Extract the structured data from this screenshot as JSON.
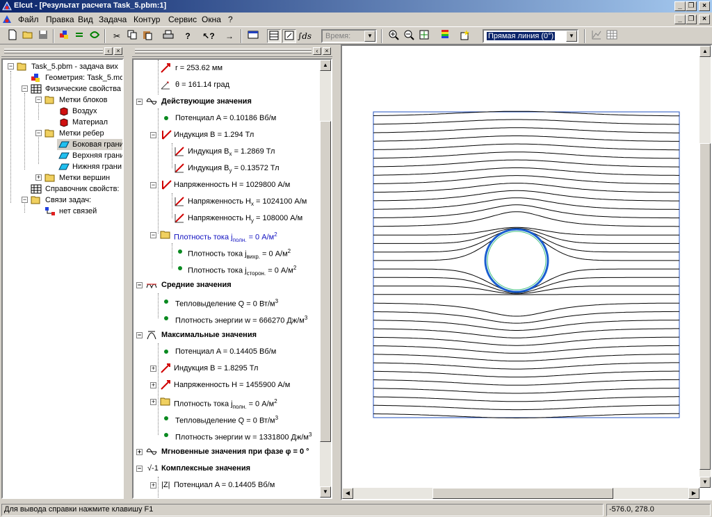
{
  "window": {
    "title": "Elcut - [Результат расчета Task_5.pbm:1]",
    "buttons": [
      "_",
      "□",
      "×"
    ]
  },
  "menu": [
    "Файл",
    "Правка",
    "Вид",
    "Задача",
    "Контур",
    "Сервис",
    "Окна",
    "?"
  ],
  "toolbar": {
    "time_combo": "Время:",
    "contour_combo": "Прямая линия (0°)"
  },
  "tree": {
    "items": [
      {
        "label": "Task_5.pbm - задача вих",
        "icon": "folder-open-icon"
      },
      {
        "label": "Геометрия: Task_5.mo",
        "icon": "geometry-icon"
      },
      {
        "label": "Физические свойства",
        "icon": "table-icon"
      },
      {
        "label": "Метки блоков",
        "icon": "folder-open-icon"
      },
      {
        "label": "Воздух",
        "icon": "block-label-icon"
      },
      {
        "label": "Материал",
        "icon": "block-label-icon"
      },
      {
        "label": "Метки ребер",
        "icon": "folder-open-icon"
      },
      {
        "label": "Боковая грани",
        "icon": "edge-label-icon"
      },
      {
        "label": "Верхняя грани",
        "icon": "edge-label-icon"
      },
      {
        "label": "Нижняя грани",
        "icon": "edge-label-icon"
      },
      {
        "label": "Метки вершин",
        "icon": "folder-icon"
      },
      {
        "label": "Справочник свойств:",
        "icon": "table-icon"
      },
      {
        "label": "Связи задач:",
        "icon": "folder-open-icon"
      },
      {
        "label": "нет связей",
        "icon": "link-icon"
      }
    ]
  },
  "props": {
    "r": "r = 253.62 мм",
    "theta": "θ = 161.14 град",
    "current_values": "Действующие значения",
    "potential": "Потенциал A = 0.10186 Вб/м",
    "induction": "Индукция B = 1.294 Тл",
    "induction_x_pre": "Индукция B",
    "induction_x_sub": "x",
    "induction_x_val": " = 1.2869 Тл",
    "induction_y_pre": "Индукция B",
    "induction_y_sub": "y",
    "induction_y_val": " = 0.13572 Тл",
    "field": "Напряженность H = 1029800 А/м",
    "field_x_pre": "Напряженность H",
    "field_x_sub": "x",
    "field_x_val": " = 1024100 А/м",
    "field_y_pre": "Напряженность H",
    "field_y_sub": "y",
    "field_y_val": " = 108000 А/м",
    "current_density_pre": "Плотность тока j",
    "current_density_sub": "полн.",
    "current_density_val": " = 0 А/м",
    "current_density_sup": "2",
    "current_eddy_pre": "Плотность тока j",
    "current_eddy_sub": "вихр.",
    "current_eddy_val": " = 0 А/м",
    "current_eddy_sup": "2",
    "current_ext_pre": "Плотность тока j",
    "current_ext_sub": "сторон.",
    "current_ext_val": " = 0 А/м",
    "current_ext_sup": "2",
    "mean_values": "Средние значения",
    "heat": "Тепловыделение Q = 0 Вт/м",
    "heat_sup": "3",
    "energy": "Плотность энергии w = 666270 Дж/м",
    "energy_sup": "3",
    "max_values": "Максимальные значения",
    "max_potential": "Потенциал A = 0.14405 Вб/м",
    "max_induction": "Индукция B = 1.8295 Тл",
    "max_field": "Напряженность H = 1455900 А/м",
    "max_current_pre": "Плотность тока j",
    "max_current_sub": "полн.",
    "max_current_val": " = 0 А/м",
    "max_current_sup": "2",
    "max_heat": "Тепловыделение Q = 0 Вт/м",
    "max_heat_sup": "3",
    "max_energy": "Плотность энергии w = 1331800 Дж/м",
    "max_energy_sup": "3",
    "instant_values": "Мгновенные значения при фазе φ = 0 °",
    "complex_values": "Комплексные значения",
    "complex_potential": "Потенциал A = 0.14405 Вб/м",
    "complex_abs": "|Z|"
  },
  "status": {
    "help": "Для вывода справки нажмите клавишу F1",
    "coords": "-576.0, 278.0"
  }
}
